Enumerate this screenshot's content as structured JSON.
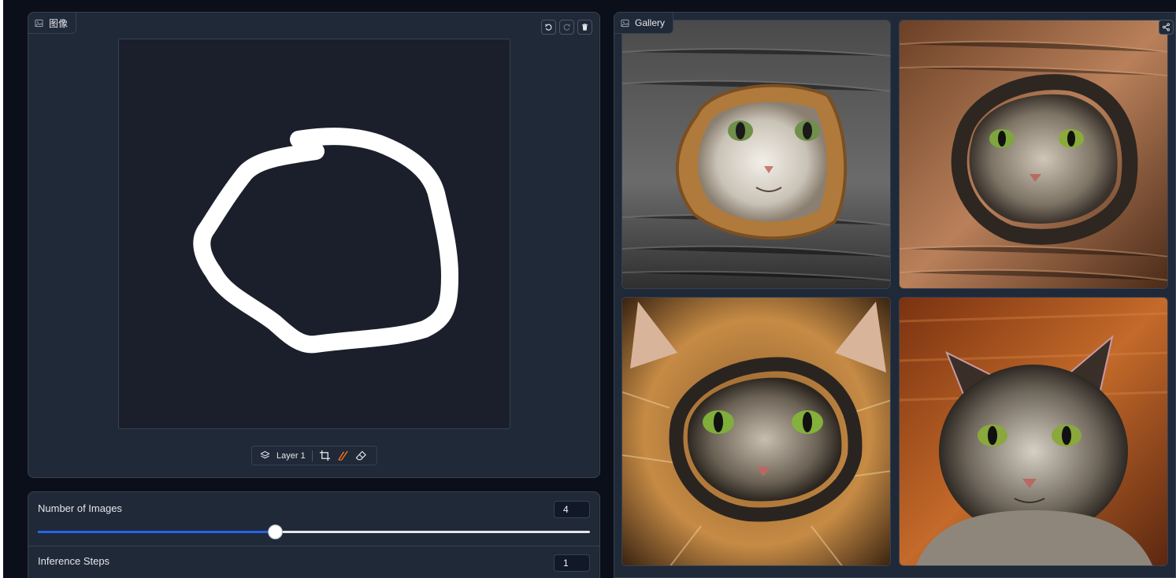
{
  "editor": {
    "label": "图像",
    "label_icon": "image-icon",
    "actions": [
      "undo-icon",
      "redo-icon",
      "trash-icon"
    ],
    "layer_label": "Layer 1",
    "tools": [
      "crop-icon",
      "brush-icon",
      "eraser-icon"
    ]
  },
  "controls": {
    "num_images": {
      "label": "Number of Images",
      "value": "4",
      "fraction": 0.43
    },
    "inference_steps": {
      "label": "Inference Steps",
      "value": "1"
    }
  },
  "gallery": {
    "label": "Gallery",
    "label_icon": "image-icon",
    "share_icon": "share-icon",
    "images": [
      {
        "name": "cat-in-bread-ring-gray"
      },
      {
        "name": "cat-in-dark-ring-brown"
      },
      {
        "name": "cat-in-ring-fur-background"
      },
      {
        "name": "tabby-cat-portrait"
      }
    ]
  },
  "colors": {
    "background": "#0b0f19",
    "panel": "#1f2937",
    "border": "#374151",
    "accent": "#2563eb",
    "brush_accent": "#f97316"
  }
}
